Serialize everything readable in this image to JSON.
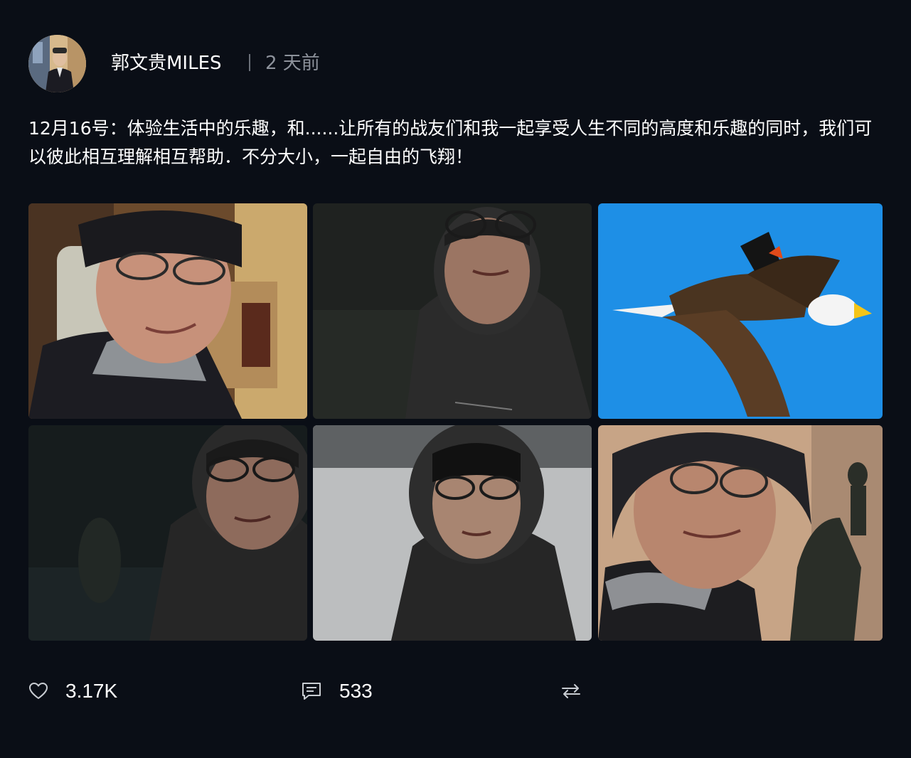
{
  "post": {
    "author": "郭文贵MILES",
    "time": "2 天前",
    "text": "12月16号：体验生活中的乐趣，和......让所有的战友们和我一起享受人生不同的高度和乐趣的同时，我们可以彼此相互理解相互帮助．不分大小，一起自由的飞翔！"
  },
  "photos": [
    {
      "label": "selfie-indoor-hat"
    },
    {
      "label": "selfie-night-snow-hood"
    },
    {
      "label": "bald-eagle-with-bird"
    },
    {
      "label": "selfie-night-hood"
    },
    {
      "label": "selfie-snow-beanie"
    },
    {
      "label": "selfie-hat-statue"
    }
  ],
  "actions": {
    "likes": "3.17K",
    "comments": "533",
    "like_icon": "heart-icon",
    "comment_icon": "comment-icon",
    "repost_icon": "repost-icon"
  },
  "colors": {
    "background": "#0a0e16",
    "text": "#ffffff",
    "muted": "#8d929b",
    "icon": "#c8ccd2",
    "sky": "#1e8fe6"
  }
}
